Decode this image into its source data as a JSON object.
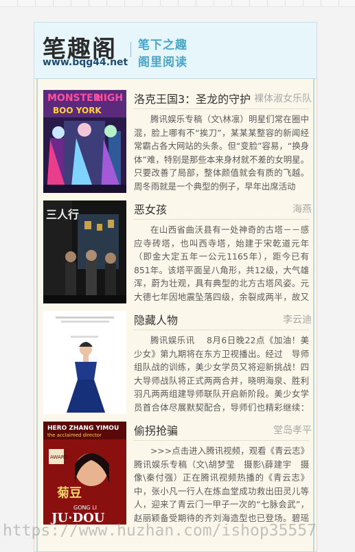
{
  "header": {
    "logo_title": "笔趣阁",
    "logo_url": "www.bqg44.net",
    "slogan_line1": "笔下之趣",
    "slogan_line2": "阁里阅读"
  },
  "books": [
    {
      "title": "洛克王国3：圣龙的守护",
      "author": "裸体淑女乐队",
      "description": "腾讯娱乐专稿（文\\林凛）明星们常在圈中混，脸上哪有不“挨刀”，某某某整容的新闻经常霸占各大网站的头条。但“变脸”容易，“换身体”难，特别是那些本来身材就不差的女明星。只要改善了局部，整体颜值就会有质的飞越。周冬雨就是一个典型的例子，早年出席活动",
      "cover_text": "MONSTER HIGH BOO YORK"
    },
    {
      "title": "恶女孩",
      "author": "海燕",
      "description": "在山西省曲沃县有一处神奇的古塔－－感应寺砖塔，也叫西寺塔，始建于宋乾道元年（即金大定五年一公元1165年），距今已有851年。该塔平面呈八角形，共12级，大气雄浑，蔚为壮观，具有典型的北方古塔风姿。元大德七年因地震坠落四级，余裂成两半，故又有“裂。",
      "cover_text": "三人行"
    },
    {
      "title": "隐藏人物",
      "author": "李云迪",
      "description": "腾讯娱乐讯　 8月6日晚22点《加油！美少女》第九期将在东方卫视播出。经过　导师组队战的训练，美少女学员又将迎新挑战！四大导师战队将正式两两合并，晓明海泉、胜利羽凡两两组建导师联队开启新阶段。美少女学员首合体尽展默契配合，导师们也精彩继续：海。",
      "cover_text": ""
    },
    {
      "title": "偷拐抢骗",
      "author": "堂岛孝平",
      "description": ">>>点击进入腾讯视频，观看《青云志》腾讯娱乐专稿（文\\胡梦莹　摄影\\薛建宇　摄像\\秦付强）正在腾讯视频热播的《青云志》中，张小凡一行人在炼血堂成功救出田灵儿等人，迎来了青云门一甲子一次的“七脉会武”，赵丽颖备受期待的齐刘海造型也已登场。碧瑶在血色枫",
      "cover_text": "JU DOU"
    }
  ],
  "watermark": "https://www.huzhan.com/ishop35557",
  "colors": {
    "header_bg": "#e6f6fb",
    "page_bg": "#fbf7ea",
    "slogan": "#4aa6c9",
    "url": "#1d4b74"
  }
}
